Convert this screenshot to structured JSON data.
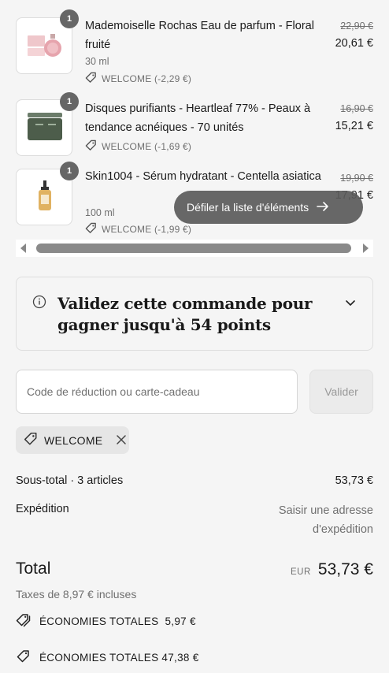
{
  "items": [
    {
      "qty": "1",
      "title": "Mademoiselle Rochas Eau de parfum - Floral fruité",
      "variant": "30 ml",
      "discount": "WELCOME (-2,29 €)",
      "price_old": "22,90 €",
      "price_new": "20,61 €",
      "thumb": "perfume-bottle"
    },
    {
      "qty": "1",
      "title": "Disques purifiants - Heartleaf 77% - Peaux à tendance acnéiques - 70 unités",
      "variant": "",
      "discount": "WELCOME (-1,69 €)",
      "price_old": "16,90 €",
      "price_new": "15,21 €",
      "thumb": "green-jar"
    },
    {
      "qty": "1",
      "title": "Skin1004 - Sérum hydratant - Centella asiatica",
      "variant": "100 ml",
      "discount": "WELCOME (-1,99 €)",
      "price_old": "19,90 €",
      "price_new": "17,91 €",
      "thumb": "serum-bottle"
    }
  ],
  "scroll_hint": "Défiler la liste d'éléments",
  "points_banner": "Validez cette commande pour gagner jusqu'à 54 points",
  "discount_field": {
    "placeholder": "Code de réduction ou carte-cadeau",
    "button": "Valider"
  },
  "applied_code": "WELCOME",
  "summary": {
    "subtotal_label": "Sous-total · 3 articles",
    "subtotal_value": "53,73 €",
    "shipping_label": "Expédition",
    "shipping_value": "Saisir une adresse d'expédition",
    "total_label": "Total",
    "currency": "EUR",
    "total_value": "53,73 €",
    "taxes": "Taxes de 8,97 € incluses",
    "savings_1": "ÉCONOMIES TOTALES  5,97 €",
    "savings_2": "ÉCONOMIES TOTALES 47,38 €"
  },
  "colors": {
    "background": "#f5f5f5",
    "text": "#1a1a1a",
    "muted": "#707070",
    "badge": "#666666"
  }
}
